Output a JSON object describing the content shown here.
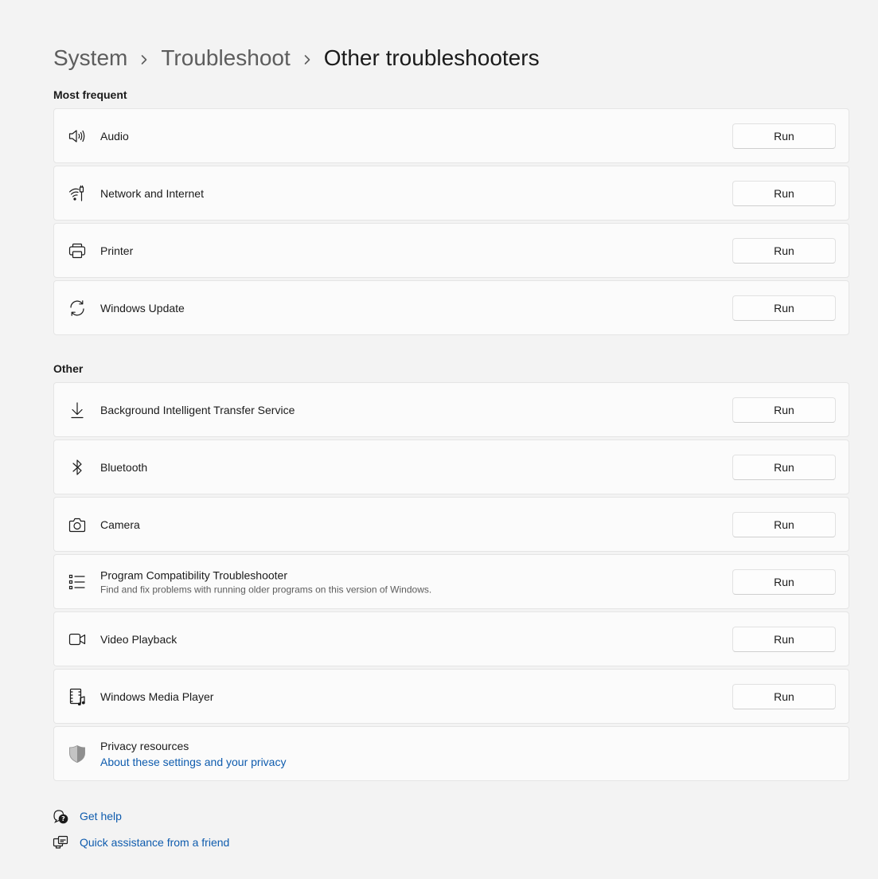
{
  "breadcrumb": {
    "items": [
      "System",
      "Troubleshoot",
      "Other troubleshooters"
    ]
  },
  "sections": {
    "most_frequent": "Most frequent",
    "other": "Other"
  },
  "most_frequent": [
    {
      "label": "Audio",
      "icon": "speaker-icon",
      "button": "Run"
    },
    {
      "label": "Network and Internet",
      "icon": "wifi-ethernet-icon",
      "button": "Run"
    },
    {
      "label": "Printer",
      "icon": "printer-icon",
      "button": "Run"
    },
    {
      "label": "Windows Update",
      "icon": "sync-icon",
      "button": "Run"
    }
  ],
  "other": [
    {
      "label": "Background Intelligent Transfer Service",
      "icon": "download-icon",
      "button": "Run"
    },
    {
      "label": "Bluetooth",
      "icon": "bluetooth-icon",
      "button": "Run"
    },
    {
      "label": "Camera",
      "icon": "camera-icon",
      "button": "Run"
    },
    {
      "label": "Program Compatibility Troubleshooter",
      "description": "Find and fix problems with running older programs on this version of Windows.",
      "icon": "list-icon",
      "button": "Run"
    },
    {
      "label": "Video Playback",
      "icon": "video-camera-icon",
      "button": "Run"
    },
    {
      "label": "Windows Media Player",
      "icon": "media-player-icon",
      "button": "Run"
    }
  ],
  "privacy": {
    "title": "Privacy resources",
    "link": "About these settings and your privacy",
    "icon": "shield-icon"
  },
  "footer": {
    "get_help": "Get help",
    "quick_assist": "Quick assistance from a friend"
  },
  "colors": {
    "background": "#f3f3f3",
    "card": "#fbfbfb",
    "link": "#0f5cae",
    "secondary_text": "#5d5d5d"
  }
}
